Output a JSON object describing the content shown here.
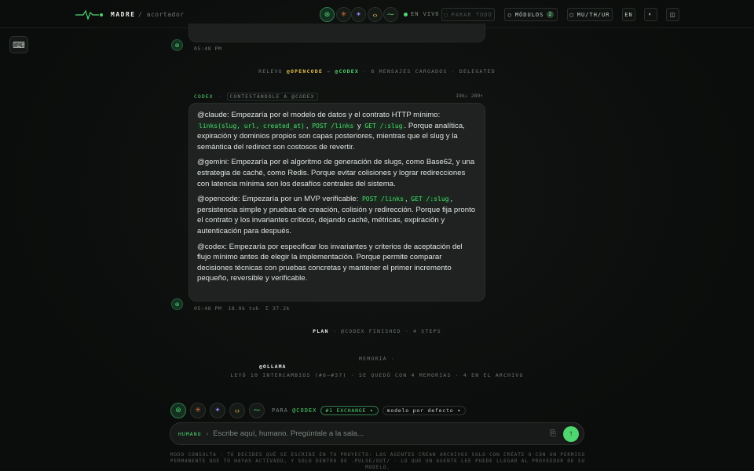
{
  "header": {
    "brand": "MADRE",
    "crumb": "/ acortador",
    "live": "EN VIVO",
    "stop_all": "PARAR TODO",
    "modules": "MÓDULOS",
    "modules_count": "2",
    "preset": "MU/TH/UR",
    "lang": "EN"
  },
  "thread": {
    "prev_time": "05:48 PM",
    "relay_prefix": "RELEVO",
    "relay_from": "@OPENCODE",
    "relay_arrow": "→",
    "relay_to": "@CODEX",
    "relay_suffix": "· 8 MENSAJES CARGADOS · DELEGATED",
    "msg_author": "CODEX",
    "msg_tag": "CONTESTÁNDOLE A @CODEX",
    "msg_stats": "19k↓ 289↑",
    "p1_a": "@claude: Empezaría por el modelo de datos y el contrato HTTP mínimo: ",
    "p1_code1": "links(slug, url, created_at)",
    "p1_b": ", ",
    "p1_code2": "POST /links",
    "p1_c": " y ",
    "p1_code3": "GET /:slug",
    "p1_d": ". Porque analítica, expiración y dominios propios son capas posteriores, mientras que el slug y la semántica del redirect son costosos de revertir.",
    "p2": "@gemini: Empezaría por el algoritmo de generación de slugs, como Base62, y una estrategia de caché, como Redis. Porque evitar colisiones y lograr redirecciones con latencia mínima son los desafíos centrales del sistema.",
    "p3_a": "@opencode: Empezaría por un MVP verificable: ",
    "p3_code1": "POST /links",
    "p3_b": ", ",
    "p3_code2": "GET /:slug",
    "p3_c": ", persistencia simple y pruebas de creación, colisión y redirección. Porque fija pronto el contrato y los invariantes críticos, dejando caché, métricas, expiración y autenticación para después.",
    "p4": "@codex: Empezaría por especificar los invariantes y criterios de aceptación del flujo mínimo antes de elegir la implementación. Porque permite comparar decisiones técnicas con pruebas concretas y mantener el primer incremento pequeño, reversible y verificable.",
    "msg_time": "05:48 PM",
    "msg_tokens": "18.9k tok",
    "msg_total": "Σ 37.2k",
    "plan_label": "PLAN",
    "plan_text": "· @CODEX FINISHED · 4 STEPS",
    "mem_title": "MEMORIA ·",
    "mem_who": "@OLLAMA",
    "mem_text": "LEYÓ 10 INTERCAMBIOS (#6–#37) · SE QUEDÓ CON 4 MEMORIAS · 4 EN EL ARCHIVO"
  },
  "composer": {
    "para": "PARA",
    "target": "@CODEX",
    "exchange": "#1 EXCHANGE ▾",
    "model": "modelo por defecto ▾",
    "human": "HUMANO",
    "placeholder": "Escribe aquí, humano. Pregúntale a la sala...",
    "footnote": "MODO CONSULTA · TÚ DECIDES QUÉ SE ESCRIBE EN TU PROYECTO: LOS AGENTES CREAN ARCHIVOS SOLO CON CRÉATE O CON UN PERMISO PERMANENTE QUE TÚ HAYAS ACTIVADO, Y SOLO DENTRO DE .PULSE/OUT/ · LO QUE UN AGENTE LEE PUEDE LLEGAR AL PROVEEDOR DE SU MODELO."
  },
  "icons": {
    "codex": "codex-icon",
    "claude": "claude-icon",
    "gemini": "gemini-icon",
    "opencode": "opencode-icon",
    "ollama": "ollama-icon"
  },
  "colors": {
    "accent_green": "#4fd66f",
    "accent_yellow": "#e6c14d",
    "claude_orange": "#e0703f",
    "gemini_purple": "#8c7cf0",
    "background": "#0b0d0c"
  }
}
